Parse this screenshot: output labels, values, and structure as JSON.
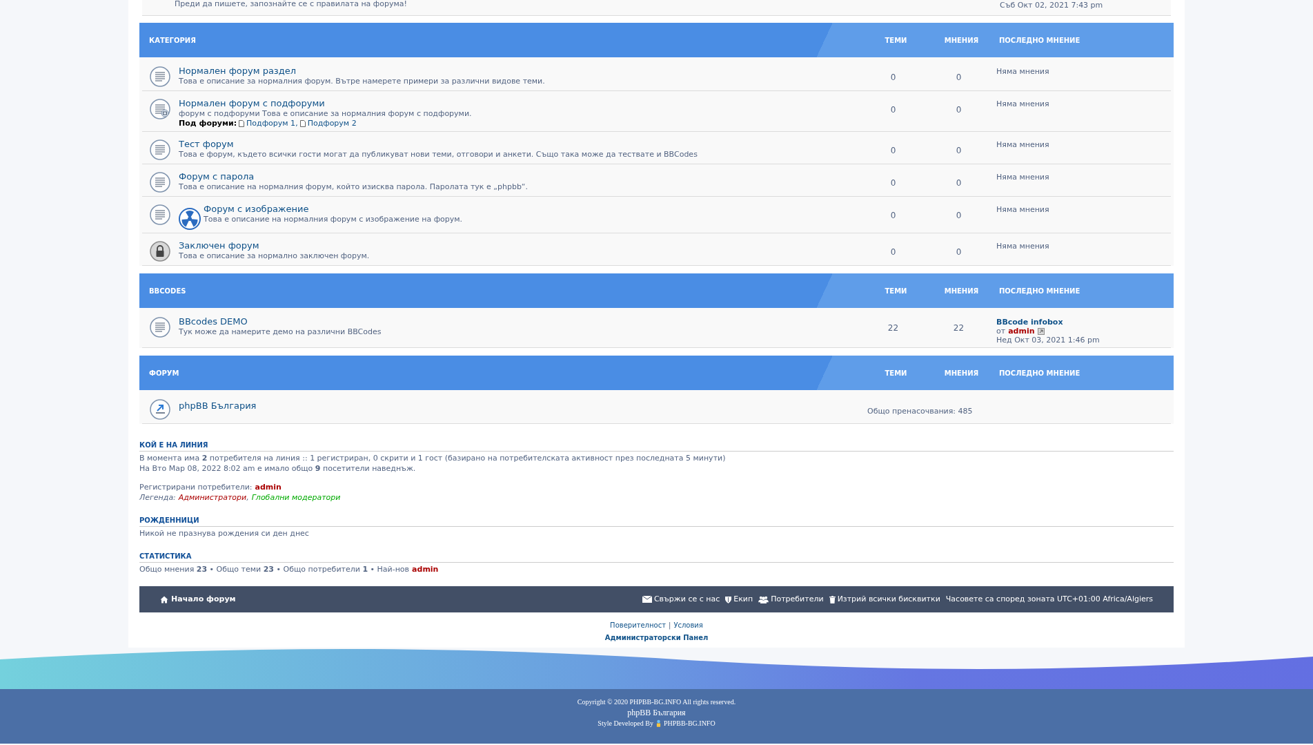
{
  "top_row": {
    "description": "Преди да пишете, запознайте се с правилата на форума!",
    "last_post_date": "Съб Окт 02, 2021 7:43 pm"
  },
  "sections": [
    {
      "title": "КАТЕГОРИЯ",
      "columns": [
        "ТЕМИ",
        "МНЕНИЯ",
        "ПОСЛЕДНО МНЕНИЕ"
      ],
      "forums": [
        {
          "kind": "normal",
          "title": "Нормален форум раздел",
          "description": "Това е описание за нормалния форум. Вътре намерете примери за различни видове теми.",
          "topics": "0",
          "posts": "0",
          "last_post": {
            "text": "Няма мнения"
          }
        },
        {
          "kind": "subforums",
          "title": "Нормален форум с подфоруми",
          "description": "форум с подфоруми Това е описание за нормалния форум с подфоруми.",
          "subforums_label": "Под форуми:",
          "subforums": [
            "Подфорум 1",
            "Подфорум 2"
          ],
          "subforum_separator": ",",
          "topics": "0",
          "posts": "0",
          "last_post": {
            "text": "Няма мнения"
          }
        },
        {
          "kind": "normal",
          "title": "Тест форум",
          "description": "Това е форум, където всички гости могат да публикуват нови теми, отговори и анкети. Също така може да тествате и BBCodes",
          "topics": "0",
          "posts": "0",
          "last_post": {
            "text": "Няма мнения"
          }
        },
        {
          "kind": "normal",
          "title": "Форум с парола",
          "description": "Това е описание на нормалния форум, който изисква парола. Паролата тук е „phpbb“.",
          "topics": "0",
          "posts": "0",
          "last_post": {
            "text": "Няма мнения"
          }
        },
        {
          "kind": "image",
          "title": "Форум с изображение",
          "description": "Това е описание на нормалния форум с изображение на форум.",
          "topics": "0",
          "posts": "0",
          "last_post": {
            "text": "Няма мнения"
          }
        },
        {
          "kind": "locked",
          "title": "Заключен форум",
          "description": "Това е описание за нормално заключен форум.",
          "topics": "0",
          "posts": "0",
          "last_post": {
            "text": "Няма мнения"
          }
        }
      ]
    },
    {
      "title": "BBCODES",
      "columns": [
        "ТЕМИ",
        "МНЕНИЯ",
        "ПОСЛЕДНО МНЕНИЕ"
      ],
      "forums": [
        {
          "kind": "normal",
          "title": "BBcodes DEMO",
          "description": "Тук може да намерите демо на различни BBCodes",
          "topics": "22",
          "posts": "22",
          "last_post": {
            "title": "BBcode infobox",
            "by": "от",
            "author": "admin",
            "date": "Нед Окт 03, 2021 1:46 pm"
          }
        }
      ]
    },
    {
      "title": "ФОРУМ",
      "columns": [
        "ТЕМИ",
        "МНЕНИЯ",
        "ПОСЛЕДНО МНЕНИЕ"
      ],
      "forums": [
        {
          "kind": "link",
          "title": "phpBB България",
          "redirects": "Общо пренасочвания: 485"
        }
      ]
    }
  ],
  "who_is_online": {
    "heading": "КОЙ Е НА ЛИНИЯ",
    "lines": [
      "В момента има **2** потребителя на линия :: 1 регистриран, 0 скрити и 1 гост (базирано на потребителската активност през последната 5 минути)",
      "На Вто Мар 08, 2022 8:02 am е имало общо **9** посетители наведнъж."
    ],
    "registered_label": "Регистрирани потребители:",
    "registered_user": "admin",
    "legend_label": "Легенда:",
    "legend": [
      {
        "name": "Администратори",
        "color": "#aa0000"
      },
      {
        "name": "Глобални модератори",
        "color": "#00aa00"
      }
    ],
    "legend_separator": ","
  },
  "birthdays": {
    "heading": "РОЖДЕННИЦИ",
    "text": "Никой не празнува рождения си ден днес"
  },
  "statistics": {
    "heading": "СТАТИСТИКА",
    "text": "Общо мнения **23** • Общо теми **23** • Общо потребители **1** • Най-нов",
    "newest_user": "admin"
  },
  "navbar": {
    "home": "Начало форум",
    "links": [
      {
        "kind": "contact",
        "label": "Свържи се с нас"
      },
      {
        "kind": "team",
        "label": "Екип"
      },
      {
        "kind": "members",
        "label": "Потребители"
      },
      {
        "kind": "cookies",
        "label": "Изтрий всички бисквитки"
      }
    ],
    "timezone": "Часовете са според зоната UTC+01:00 Africa/Algiers"
  },
  "page_links": {
    "privacy": "Поверителност",
    "separator": "|",
    "terms": "Условия",
    "acp": "Администраторски Панел"
  },
  "copyright": {
    "text": "Copyright © 2020 PHPBB-BG.INFO All rights reserved.",
    "site": "phpBB България",
    "developed_by": "Style Developed By",
    "developer": "PHPBB-BG.INFO"
  }
}
